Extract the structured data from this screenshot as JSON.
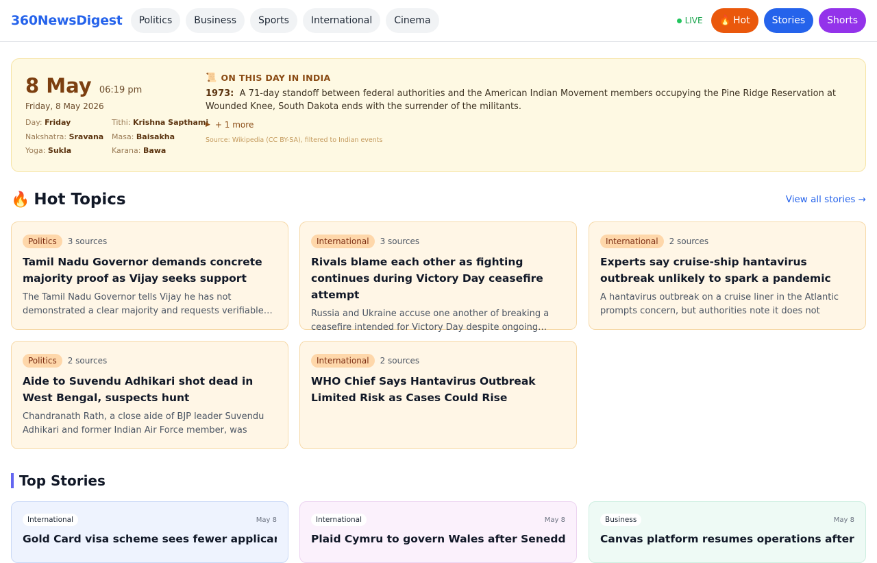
{
  "header": {
    "logo": "360NewsDigest",
    "nav": [
      "Politics",
      "Business",
      "Sports",
      "International",
      "Cinema"
    ],
    "live_label": "LIVE",
    "hot_label": "Hot",
    "stories_label": "Stories",
    "shorts_label": "Shorts"
  },
  "on_this_day": {
    "date_short": "8 May",
    "time": "06:19 pm",
    "date_full": "Friday, 8 May 2026",
    "panchang": {
      "day_label": "Day:",
      "day": "Friday",
      "tithi_label": "Tithi:",
      "tithi": "Krishna Sapthami",
      "nakshatra_label": "Nakshatra:",
      "nakshatra": "Sravana",
      "masa_label": "Masa:",
      "masa": "Baisakha",
      "yoga_label": "Yoga:",
      "yoga": "Sukla",
      "karana_label": "Karana:",
      "karana": "Bawa"
    },
    "heading": "ON THIS DAY IN INDIA",
    "event_year": "1973:",
    "event_text": "A 71-day standoff between federal authorities and the American Indian Movement members occupying the Pine Ridge Reservation at Wounded Knee, South Dakota ends with the surrender of the militants.",
    "more_label": "+ 1 more",
    "source": "Source: Wikipedia (CC BY-SA), filtered to Indian events"
  },
  "hot_topics": {
    "title": "Hot Topics",
    "view_all": "View all stories →",
    "cards": [
      {
        "tag": "Politics",
        "sources": "3 sources",
        "title": "Tamil Nadu Governor demands concrete majority proof as Vijay seeks support",
        "desc": "The Tamil Nadu Governor tells Vijay he has not demonstrated a clear majority and requests verifiable…"
      },
      {
        "tag": "International",
        "sources": "3 sources",
        "title": "Rivals blame each other as fighting continues during Victory Day ceasefire attempt",
        "desc": "Russia and Ukraine accuse one another of breaking a ceasefire intended for Victory Day despite ongoing…"
      },
      {
        "tag": "International",
        "sources": "2 sources",
        "title": "Experts say cruise-ship hantavirus outbreak unlikely to spark a pandemic",
        "desc": "A hantavirus outbreak on a cruise liner in the Atlantic prompts concern, but authorities note it does not easily…"
      },
      {
        "tag": "Politics",
        "sources": "2 sources",
        "title": "Aide to Suvendu Adhikari shot dead in West Bengal, suspects hunt",
        "desc": "Chandranath Rath, a close aide of BJP leader Suvendu Adhikari and former Indian Air Force member, was shot…"
      },
      {
        "tag": "International",
        "sources": "2 sources",
        "title": "WHO Chief Says Hantavirus Outbreak Limited Risk as Cases Could Rise",
        "desc": ""
      }
    ]
  },
  "top_stories": {
    "title": "Top Stories",
    "cards": [
      {
        "tag": "International",
        "date": "May 8",
        "title": "Gold Card visa scheme sees fewer applicants"
      },
      {
        "tag": "International",
        "date": "May 8",
        "title": "Plaid Cymru to govern Wales after Senedd"
      },
      {
        "tag": "Business",
        "date": "May 8",
        "title": "Canvas platform resumes operations after"
      }
    ]
  }
}
